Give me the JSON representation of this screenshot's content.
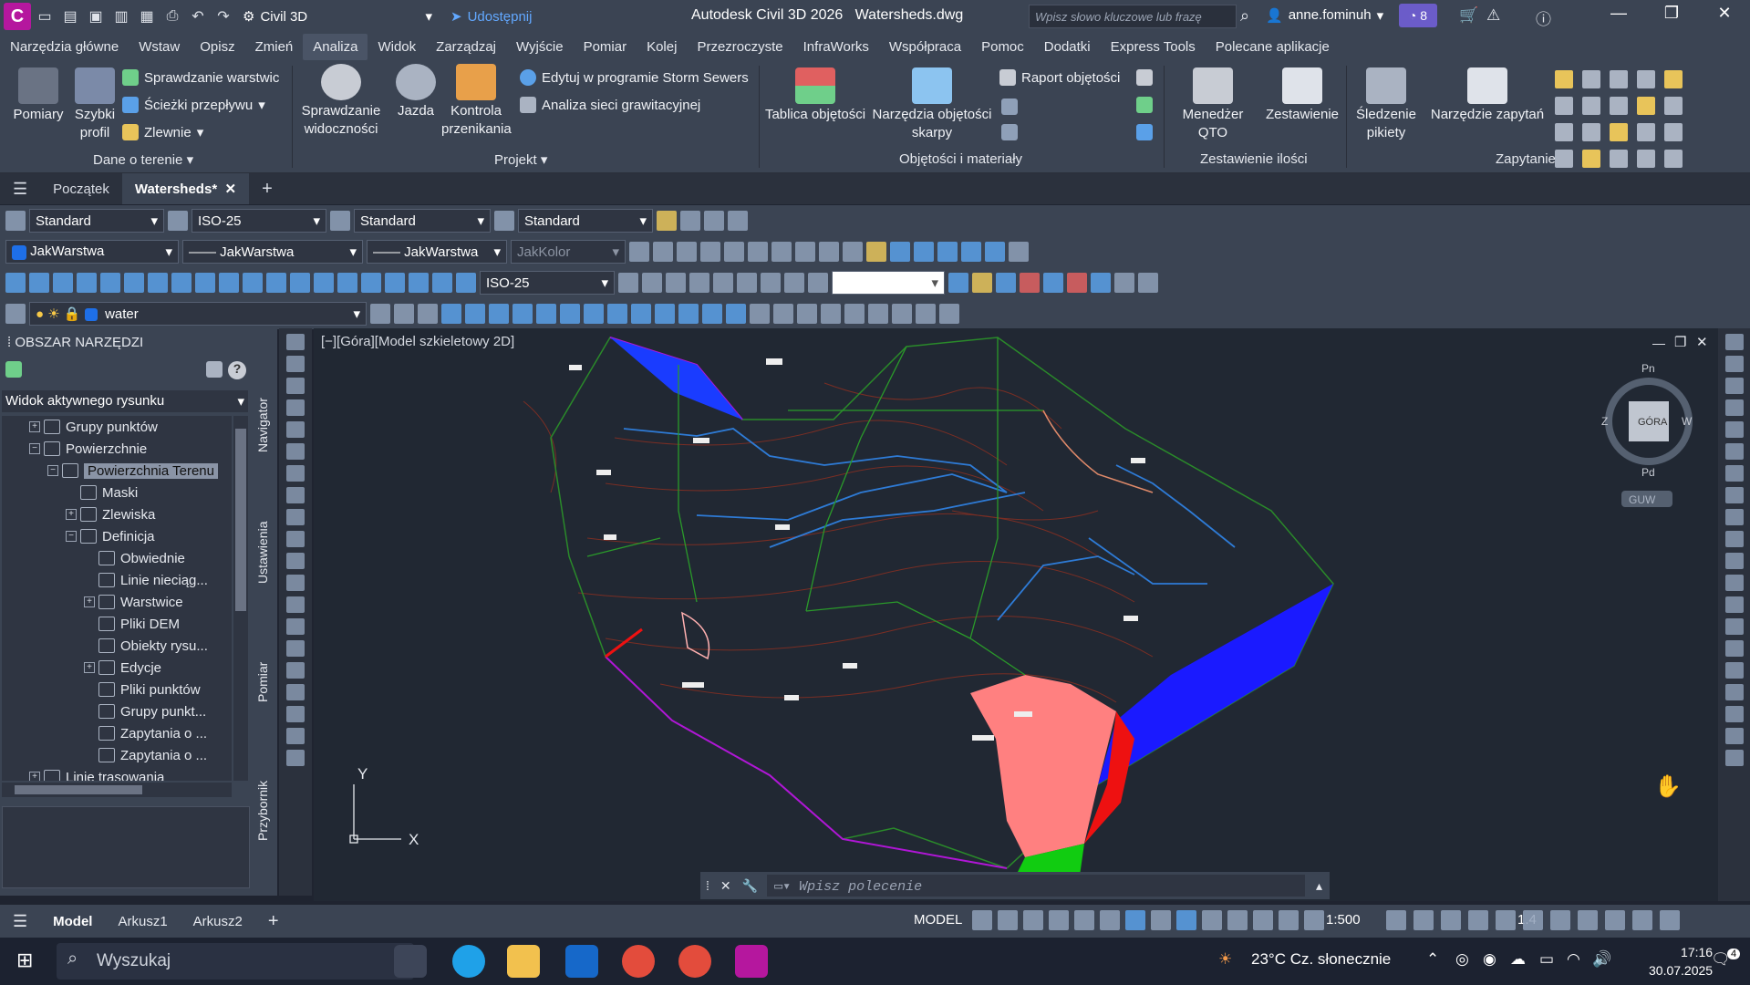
{
  "titlebar": {
    "workspace": "Civil 3D",
    "share": "Udostępnij",
    "app_title": "Autodesk Civil 3D 2026",
    "file": "Watersheds.dwg",
    "search_placeholder": "Wpisz słowo kluczowe lub frazę",
    "user": "anne.fominuh",
    "notifications": "8",
    "logo": "C"
  },
  "menu_tabs": [
    "Narzędzia główne",
    "Wstaw",
    "Opisz",
    "Zmień",
    "Analiza",
    "Widok",
    "Zarządzaj",
    "Wyjście",
    "Pomiar",
    "Kolej",
    "Przezroczyste",
    "InfraWorks",
    "Współpraca",
    "Pomoc",
    "Dodatki",
    "Express Tools",
    "Polecane aplikacje"
  ],
  "ribbon": {
    "pomiary": "Pomiary",
    "szybki_profil": "Szybki profil",
    "sprawdzanie_warstwic": "Sprawdzanie warstwic",
    "sciezki": "Ścieżki przepływu",
    "zlewnie": "Zlewnie",
    "dane_o_terenie": "Dane o terenie",
    "sprawdzanie_widocznosci": "Sprawdzanie widoczności",
    "jazda": "Jazda",
    "kontrola": "Kontrola przenikania",
    "storm": "Edytuj w programie Storm Sewers",
    "analiza_sieci": "Analiza sieci grawitacyjnej",
    "projekt": "Projekt",
    "tablica": "Tablica objętości",
    "narzedzia_obj": "Narzędzia objętości skarpy",
    "raport": "Raport objętości",
    "objetosci_materialy": "Objętości i materiały",
    "menedzer": "Menedżer QTO",
    "zestawienie": "Zestawienie",
    "zestawienie_ilosci": "Zestawienie ilości",
    "sledzenie": "Śledzenie pikiety",
    "narzedzie_zapytan": "Narzędzie zapytań",
    "zapytanie": "Zapytanie"
  },
  "doc_tabs": {
    "start": "Początek",
    "active": "Watersheds*"
  },
  "toolbars": {
    "text_style": "Standard",
    "dim_style": "ISO-25",
    "table_style": "Standard",
    "mleader_style": "Standard",
    "layer_color": "JakWarstwa",
    "linetype": "JakWarstwa",
    "lineweight": "JakWarstwa",
    "plotstyle": "JakKolor",
    "dim_style2": "ISO-25",
    "layer": "water"
  },
  "toolspace": {
    "title": "OBSZAR NARZĘDZI",
    "view": "Widok aktywnego rysunku",
    "tree": [
      {
        "label": "Grupy punktów",
        "indent": 1,
        "exp": "+"
      },
      {
        "label": "Powierzchnie",
        "indent": 1,
        "exp": "−"
      },
      {
        "label": "Powierzchnia Terenu",
        "indent": 2,
        "exp": "−",
        "selected": true
      },
      {
        "label": "Maski",
        "indent": 3,
        "exp": ""
      },
      {
        "label": "Zlewiska",
        "indent": 3,
        "exp": "+"
      },
      {
        "label": "Definicja",
        "indent": 3,
        "exp": "−"
      },
      {
        "label": "Obwiednie",
        "indent": 4,
        "exp": ""
      },
      {
        "label": "Linie nieciąg...",
        "indent": 4,
        "exp": ""
      },
      {
        "label": "Warstwice",
        "indent": 4,
        "exp": "+"
      },
      {
        "label": "Pliki DEM",
        "indent": 4,
        "exp": ""
      },
      {
        "label": "Obiekty rysu...",
        "indent": 4,
        "exp": ""
      },
      {
        "label": "Edycje",
        "indent": 4,
        "exp": "+"
      },
      {
        "label": "Pliki punktów",
        "indent": 4,
        "exp": ""
      },
      {
        "label": "Grupy punkt...",
        "indent": 4,
        "exp": ""
      },
      {
        "label": "Zapytania o ...",
        "indent": 4,
        "exp": ""
      },
      {
        "label": "Zapytania o ...",
        "indent": 4,
        "exp": ""
      },
      {
        "label": "Linie trasowania",
        "indent": 1,
        "exp": "+"
      }
    ],
    "side_tabs": [
      "Navigator",
      "Ustawienia",
      "Pomiar",
      "Przybornik"
    ]
  },
  "viewport": {
    "label": "[−][Góra][Model szkieletowy 2D]",
    "viewcube": {
      "top": "GÓRA",
      "n": "Pn",
      "s": "Pd",
      "e": "W",
      "w": "Z",
      "ucs": "GUW"
    },
    "axis_x": "X",
    "axis_y": "Y"
  },
  "command": {
    "placeholder": "Wpisz polecenie"
  },
  "status": {
    "layouts": [
      "Model",
      "Arkusz1",
      "Arkusz2"
    ],
    "mode": "MODEL",
    "scale": "1:500",
    "lineweight": "1.4"
  },
  "taskbar": {
    "search": "Wyszukaj",
    "weather": "23°C Cz. słonecznie",
    "time": "17:16",
    "date": "30.07.2025",
    "notif": "4"
  },
  "colors": {
    "accent": "#62a8ff",
    "bg": "#212833",
    "panel": "#3b4453"
  }
}
